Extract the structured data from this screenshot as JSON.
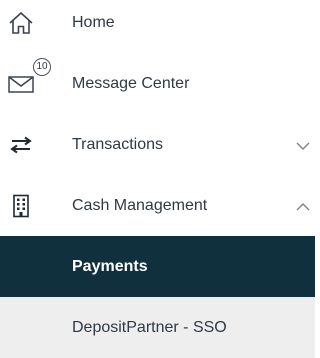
{
  "nav": {
    "items": [
      {
        "label": "Home",
        "icon": "home-icon"
      },
      {
        "label": "Message Center",
        "icon": "envelope-icon",
        "badge": "10"
      },
      {
        "label": "Transactions",
        "icon": "transfer-arrows-icon",
        "chevron": "down"
      },
      {
        "label": "Cash Management",
        "icon": "building-icon",
        "chevron": "up"
      }
    ],
    "submenu": [
      {
        "label": "Payments",
        "active": true
      },
      {
        "label": "DepositPartner - SSO",
        "active": false
      }
    ]
  },
  "colors": {
    "active_bg": "#11303e",
    "submenu_bg": "#eeeeee",
    "text": "#2f3a44"
  }
}
